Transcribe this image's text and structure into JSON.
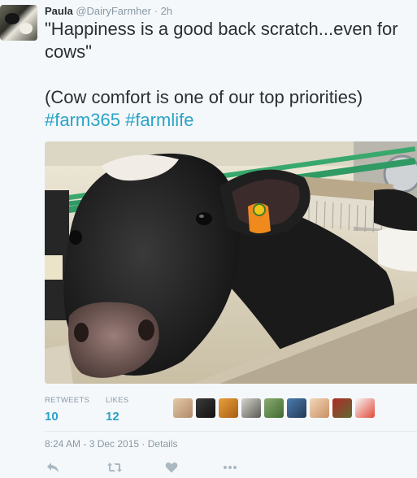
{
  "user": {
    "name": "Paula",
    "handle": "@DairyFarmher",
    "time": "2h",
    "separator": "·"
  },
  "tweet": {
    "line1": "\"Happiness is a good back scratch...even for cows\"",
    "line2": "(Cow comfort is one of our top priorities)",
    "hashtags": [
      "#farm365",
      "#farmlife"
    ]
  },
  "stats": {
    "retweets_label": "RETWEETS",
    "retweets_value": "10",
    "likes_label": "LIKES",
    "likes_value": "12"
  },
  "likers": [
    "liker-avatar",
    "liker-avatar",
    "liker-avatar",
    "liker-avatar",
    "liker-avatar",
    "liker-avatar",
    "liker-avatar",
    "liker-avatar",
    "liker-avatar",
    "liker-avatar"
  ],
  "footer": {
    "timestamp": "8:24 AM - 3 Dec 2015",
    "separator": "·",
    "details": "Details"
  },
  "colors": {
    "link": "#2aa3c7",
    "muted": "#8899a6",
    "text": "#292f33",
    "background": "#f5f8fa"
  },
  "actions": [
    "reply-icon",
    "retweet-icon",
    "like-icon",
    "more-icon"
  ]
}
